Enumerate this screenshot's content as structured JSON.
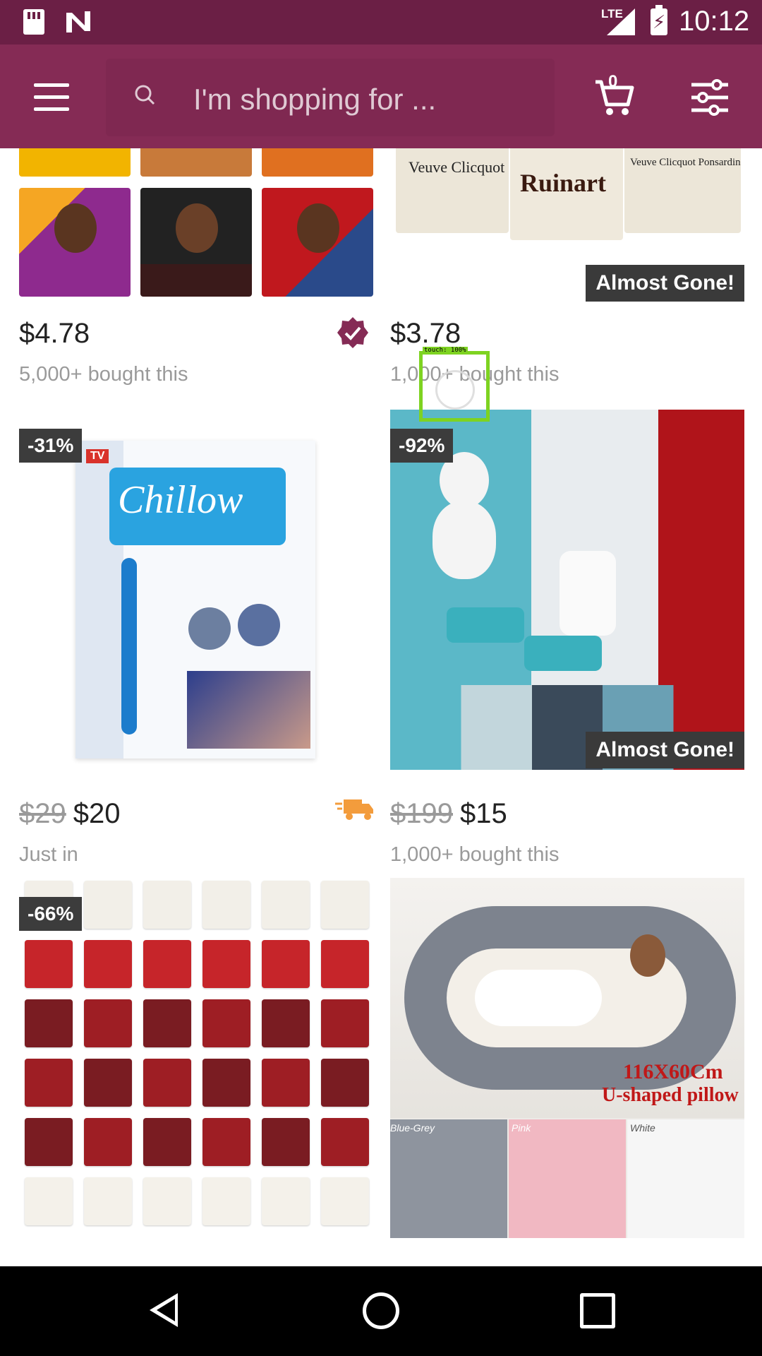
{
  "status_bar": {
    "time": "10:12",
    "network": "LTE",
    "icons": [
      "sd-card-icon",
      "n-logo-icon",
      "signal-icon",
      "battery-charging-icon"
    ]
  },
  "header": {
    "search_placeholder": "I'm shopping for ...",
    "cart_count": "0",
    "icons": [
      "menu-icon",
      "search-icon",
      "cart-icon",
      "filter-icon"
    ]
  },
  "products": [
    {
      "discount": "",
      "old_price": "",
      "price": "$4.78",
      "subtitle": "5,000+ bought this",
      "flag": "",
      "extra_icon": "verified-badge-icon"
    },
    {
      "discount": "",
      "old_price": "",
      "price": "$3.78",
      "subtitle": "1,000+ bought this",
      "flag": "Almost Gone!",
      "extra_icon": ""
    },
    {
      "discount": "-31%",
      "old_price": "$29",
      "price": "$20",
      "subtitle": "Just in",
      "flag": "",
      "extra_icon": "fast-shipping-truck-icon"
    },
    {
      "discount": "-92%",
      "old_price": "$199",
      "price": "$15",
      "subtitle": "1,000+ bought this",
      "flag": "Almost Gone!",
      "extra_icon": ""
    },
    {
      "discount": "-66%",
      "old_price": "",
      "price": "",
      "subtitle": "",
      "flag": "",
      "extra_icon": ""
    },
    {
      "discount": "",
      "old_price": "",
      "price": "",
      "subtitle": "",
      "flag": "",
      "extra_icon": ""
    }
  ],
  "image_text": {
    "champagne_brands": [
      "Veuve Clicquot",
      "Ruinart",
      "Veuve Clicquot Ponsardin"
    ],
    "chillow_brand": "Chillow",
    "pillow_size": "116X60Cm",
    "pillow_type": "U-shaped pillow",
    "pillow_colors": [
      "Blue-Grey",
      "Pink",
      "White"
    ]
  },
  "overlay": {
    "label": "touch: 100%"
  },
  "colors": {
    "brand": "#852b55",
    "status_bar": "#6b1f45",
    "badge": "#3c3c3c",
    "shipping": "#f39c3c"
  },
  "nav_bar": {
    "icons": [
      "back-icon",
      "home-icon",
      "recents-icon"
    ]
  }
}
